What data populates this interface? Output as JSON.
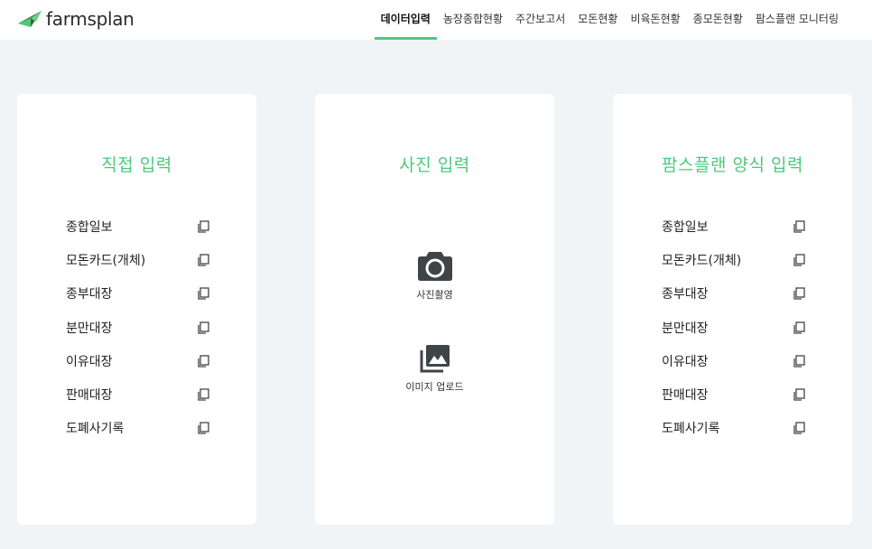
{
  "brand": {
    "name": "farmsplan"
  },
  "nav": {
    "items": [
      {
        "label": "데이터입력",
        "active": true
      },
      {
        "label": "농장종합현황",
        "active": false
      },
      {
        "label": "주간보고서",
        "active": false
      },
      {
        "label": "모돈현황",
        "active": false
      },
      {
        "label": "비육돈현황",
        "active": false
      },
      {
        "label": "종모돈현황",
        "active": false
      },
      {
        "label": "팜스플랜 모니터링",
        "active": false
      }
    ]
  },
  "direct": {
    "title": "직접 입력",
    "items": [
      "종합일보",
      "모돈카드(개체)",
      "종부대장",
      "분만대장",
      "이유대장",
      "판매대장",
      "도폐사기록"
    ]
  },
  "photo": {
    "title": "사진 입력",
    "camera_label": "사진촬영",
    "upload_label": "이미지 업로드"
  },
  "form": {
    "title": "팜스플랜 양식 입력",
    "items": [
      "종합일보",
      "모돈카드(개체)",
      "종부대장",
      "분만대장",
      "이유대장",
      "판매대장",
      "도폐사기록"
    ]
  },
  "colors": {
    "accent": "#4cc97b",
    "background": "#f1f4f7",
    "logo_dark": "#2f6b3a"
  },
  "icons": {
    "copy": "copy-icon",
    "camera": "camera-icon",
    "upload": "image-upload-icon"
  }
}
